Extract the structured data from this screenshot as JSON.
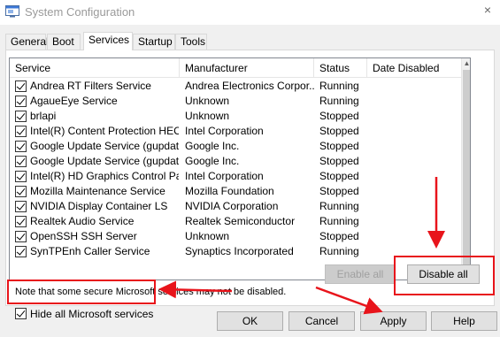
{
  "window": {
    "title": "System Configuration",
    "close_glyph": "×"
  },
  "tabs": [
    {
      "label": "General"
    },
    {
      "label": "Boot"
    },
    {
      "label": "Services",
      "active": true
    },
    {
      "label": "Startup"
    },
    {
      "label": "Tools"
    }
  ],
  "columns": {
    "service": "Service",
    "manufacturer": "Manufacturer",
    "status": "Status",
    "date_disabled": "Date Disabled"
  },
  "services": [
    {
      "name": "Andrea RT Filters Service",
      "manufacturer": "Andrea Electronics Corpor...",
      "status": "Running"
    },
    {
      "name": "AgaueEye Service",
      "manufacturer": "Unknown",
      "status": "Running"
    },
    {
      "name": "brlapi",
      "manufacturer": "Unknown",
      "status": "Stopped"
    },
    {
      "name": "Intel(R) Content Protection HEC...",
      "manufacturer": "Intel Corporation",
      "status": "Stopped"
    },
    {
      "name": "Google Update Service (gupdate)",
      "manufacturer": "Google Inc.",
      "status": "Stopped"
    },
    {
      "name": "Google Update Service (gupdatem)",
      "manufacturer": "Google Inc.",
      "status": "Stopped"
    },
    {
      "name": "Intel(R) HD Graphics Control Pa...",
      "manufacturer": "Intel Corporation",
      "status": "Stopped"
    },
    {
      "name": "Mozilla Maintenance Service",
      "manufacturer": "Mozilla Foundation",
      "status": "Stopped"
    },
    {
      "name": "NVIDIA Display Container LS",
      "manufacturer": "NVIDIA Corporation",
      "status": "Running"
    },
    {
      "name": "Realtek Audio Service",
      "manufacturer": "Realtek Semiconductor",
      "status": "Running"
    },
    {
      "name": "OpenSSH SSH Server",
      "manufacturer": "Unknown",
      "status": "Stopped"
    },
    {
      "name": "SynTPEnh Caller Service",
      "manufacturer": "Synaptics Incorporated",
      "status": "Running"
    }
  ],
  "note": "Note that some secure Microsoft services may not be disabled.",
  "buttons": {
    "enable_all": "Enable all",
    "disable_all": "Disable all",
    "ok": "OK",
    "cancel": "Cancel",
    "apply": "Apply",
    "help": "Help"
  },
  "hide_ms": {
    "label": "Hide all Microsoft services",
    "checked": true
  },
  "icons": {
    "app": "msconfig-window-icon",
    "scroll_up": "▲",
    "scroll_down": "▼"
  },
  "annotation_color": "#e8141b"
}
